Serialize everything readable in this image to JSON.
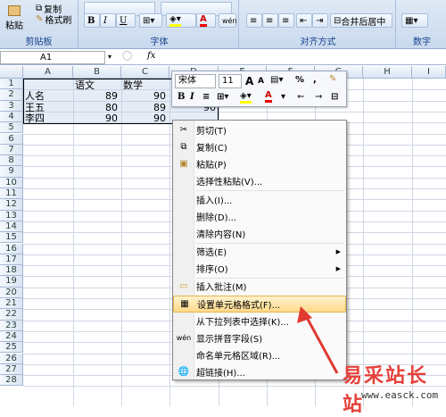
{
  "ribbon": {
    "clipboard": {
      "paste": "粘贴",
      "copy": "复制",
      "format_painter": "格式刷",
      "label": "剪贴板"
    },
    "font": {
      "bold": "B",
      "italic": "I",
      "underline": "U",
      "label": "字体",
      "wen": "wén"
    },
    "align": {
      "merge": "合并后居中",
      "label": "对齐方式"
    },
    "number": {
      "label": "数字"
    }
  },
  "formula_bar": {
    "name_box": "A1",
    "fx": "fx"
  },
  "columns": [
    "A",
    "B",
    "C",
    "D",
    "E",
    "F",
    "G",
    "H",
    "I"
  ],
  "rows": [
    "1",
    "2",
    "3",
    "4",
    "5",
    "6",
    "7",
    "8",
    "9",
    "10",
    "11",
    "12",
    "13",
    "14",
    "15",
    "16",
    "17",
    "18",
    "19",
    "20",
    "21",
    "22",
    "23",
    "24",
    "25",
    "26",
    "27",
    "28"
  ],
  "cells": {
    "b1": "语文",
    "c1": "数学",
    "a2": "人名",
    "b2": "89",
    "c2": "90",
    "a3": "王五",
    "b3": "80",
    "c3": "89",
    "a4": "李四",
    "b4": "90",
    "c4": "90",
    "d4": "90"
  },
  "mini_toolbar": {
    "font": "宋体",
    "size": "11",
    "grow": "A",
    "shrink": "A",
    "percent": "%",
    "comma": ",",
    "bold": "B",
    "italic": "I",
    "font_color": "A"
  },
  "context_menu": {
    "items": [
      {
        "label": "剪切(T)",
        "icon": "scissors-icon"
      },
      {
        "label": "复制(C)",
        "icon": "copy-icon"
      },
      {
        "label": "粘贴(P)",
        "icon": "paste-icon"
      },
      {
        "label": "选择性粘贴(V)...",
        "icon": ""
      },
      {
        "label": "插入(I)...",
        "icon": ""
      },
      {
        "label": "删除(D)...",
        "icon": ""
      },
      {
        "label": "清除内容(N)",
        "icon": ""
      },
      {
        "label": "筛选(E)",
        "icon": ""
      },
      {
        "label": "排序(O)",
        "icon": ""
      },
      {
        "label": "插入批注(M)",
        "icon": "comment-icon"
      },
      {
        "label": "设置单元格格式(F)...",
        "icon": "format-cells-icon"
      },
      {
        "label": "从下拉列表中选择(K)...",
        "icon": ""
      },
      {
        "label": "显示拼音字段(S)",
        "icon": "phonetic-icon"
      },
      {
        "label": "命名单元格区域(R)...",
        "icon": ""
      },
      {
        "label": "超链接(H)...",
        "icon": "hyperlink-icon"
      }
    ],
    "phonetic_glyph": "wén"
  },
  "watermark": {
    "title": "易采站长站",
    "url": "www.easck.com"
  },
  "colors": {
    "highlight": "#ffd98a",
    "arrow": "#e03a32",
    "watermark": "#e6413b"
  }
}
